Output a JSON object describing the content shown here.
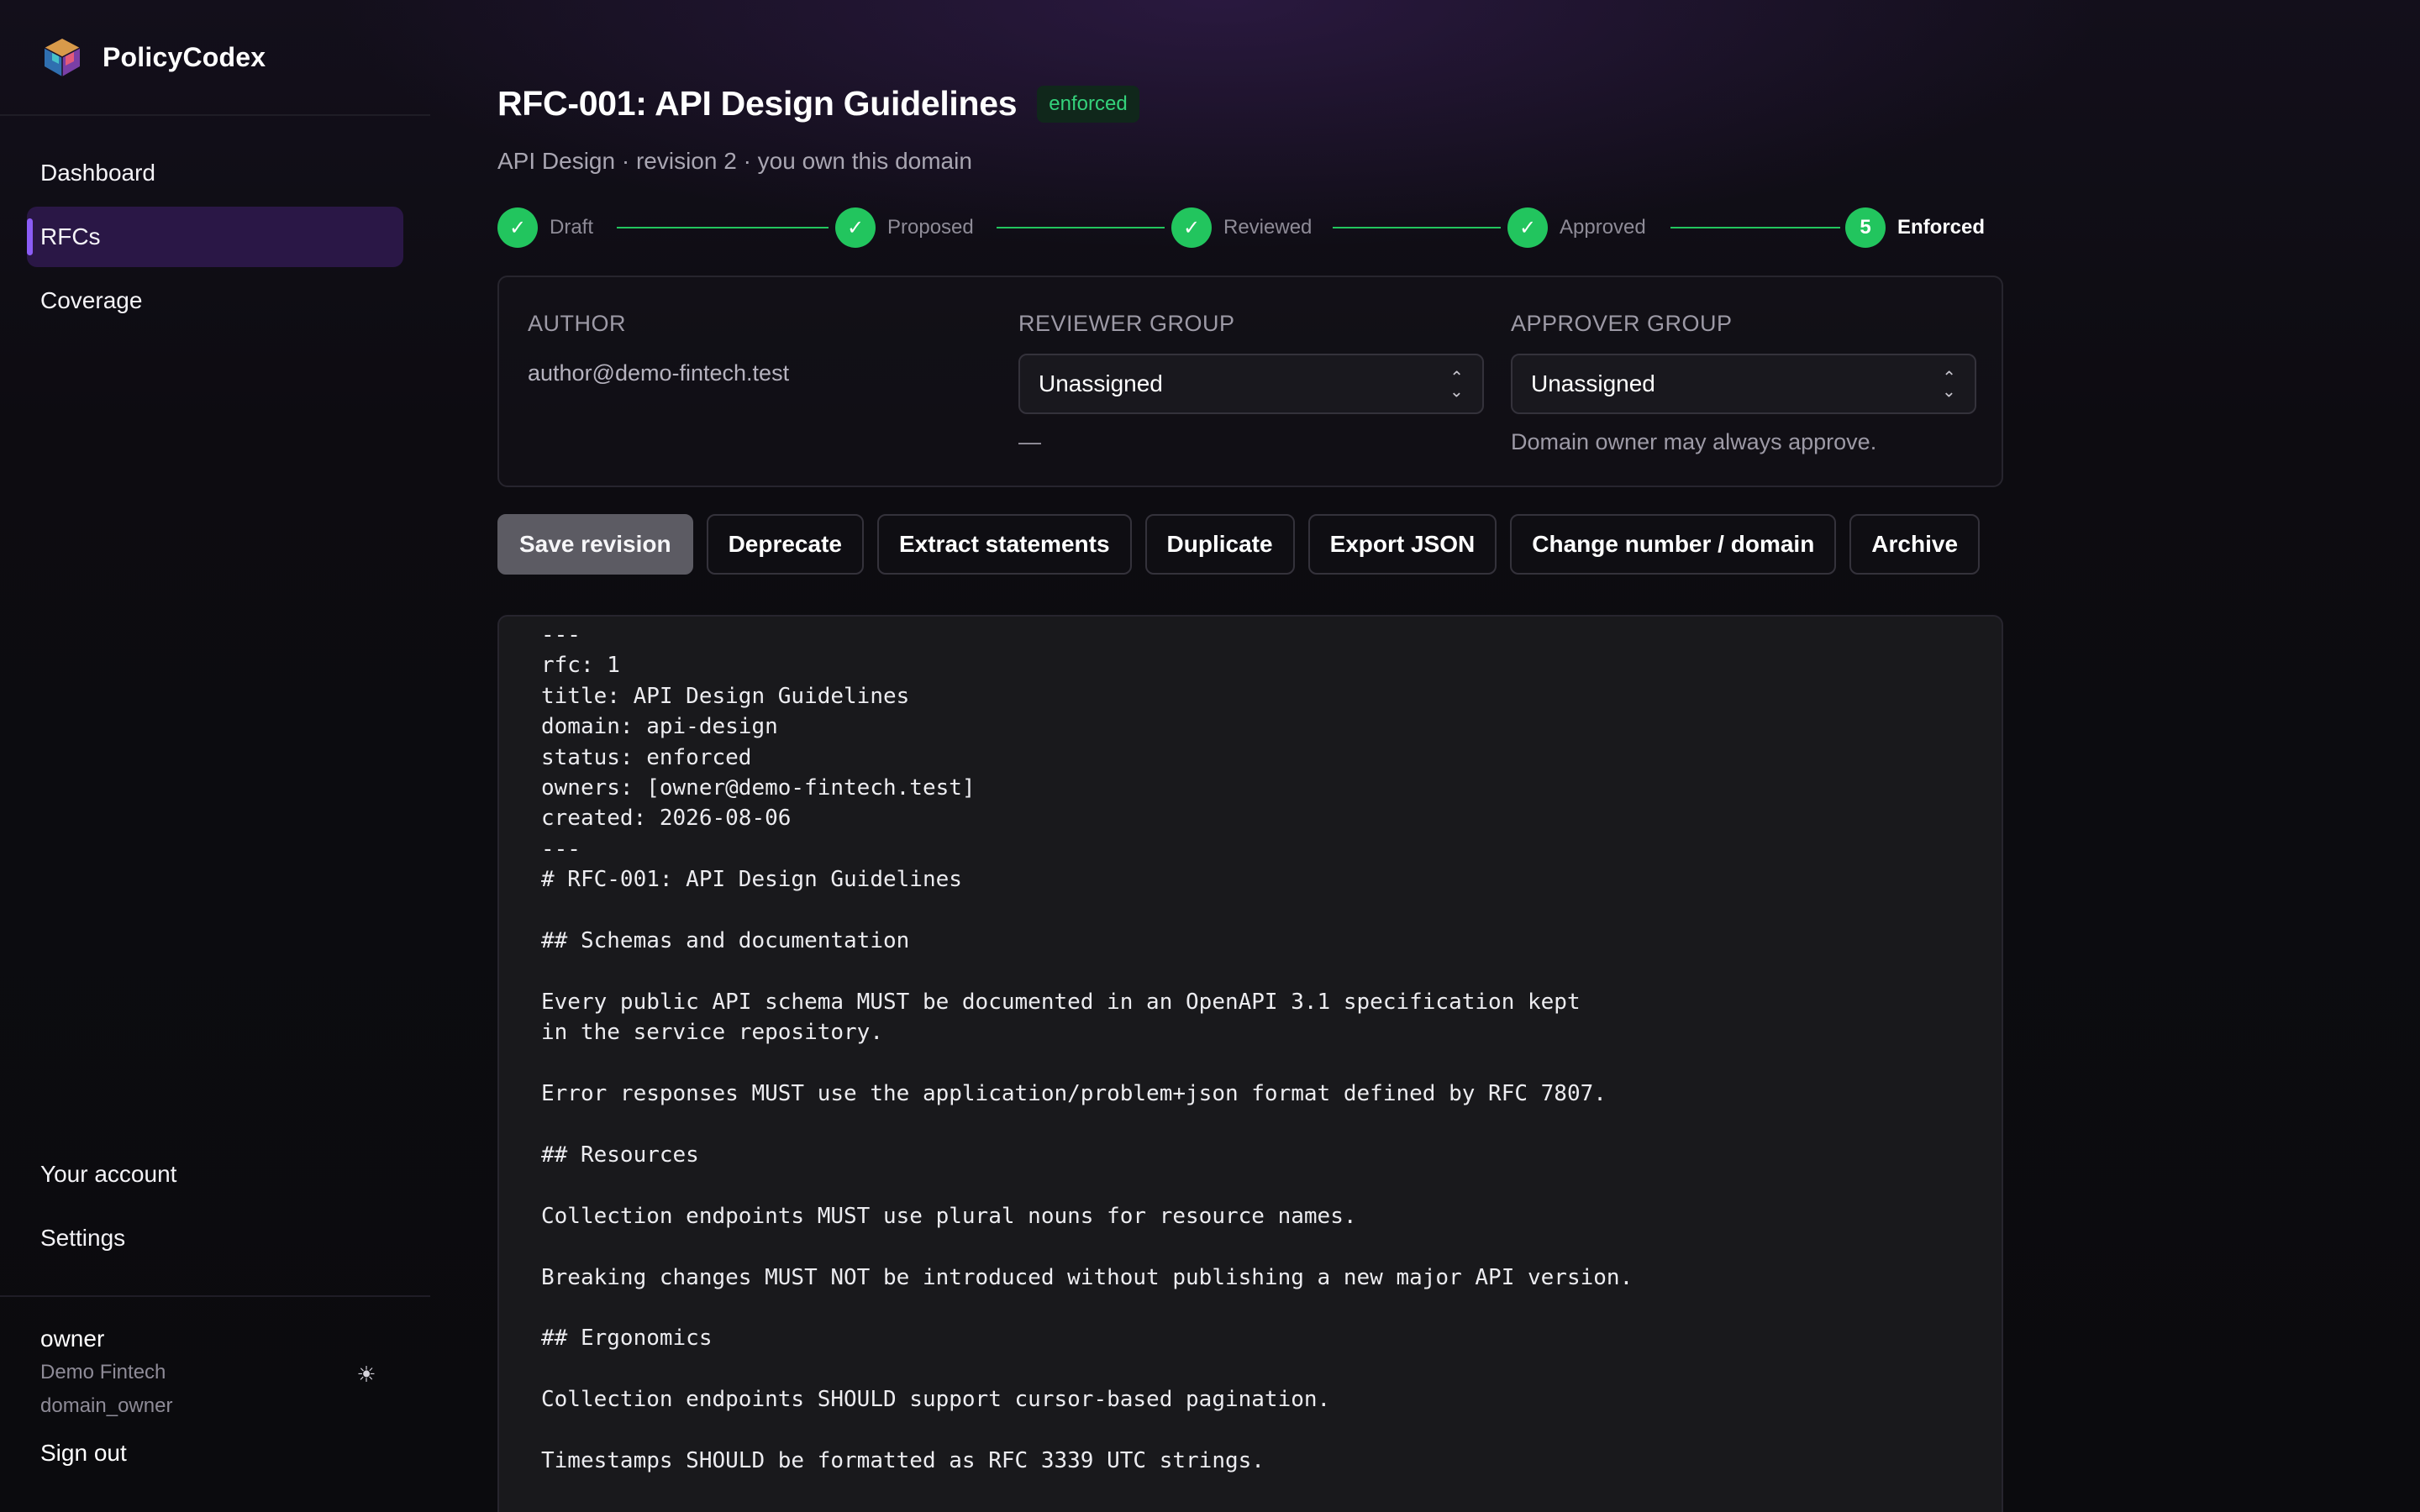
{
  "app": {
    "name": "PolicyCodex"
  },
  "nav": [
    {
      "label": "Dashboard"
    },
    {
      "label": "RFCs"
    },
    {
      "label": "Coverage"
    }
  ],
  "nav_active": "RFCs",
  "nav_bottom": [
    {
      "label": "Your account"
    },
    {
      "label": "Settings"
    }
  ],
  "user": {
    "name": "owner",
    "org": "Demo Fintech",
    "role": "domain_owner",
    "sign_out": "Sign out"
  },
  "rfc": {
    "title": "RFC-001: API Design Guidelines",
    "status": "enforced",
    "subtitle": "API Design · revision 2 · you own this domain"
  },
  "stepper": [
    {
      "label": "Draft",
      "state": "done",
      "marker": "✓"
    },
    {
      "label": "Proposed",
      "state": "done",
      "marker": "✓"
    },
    {
      "label": "Reviewed",
      "state": "done",
      "marker": "✓"
    },
    {
      "label": "Approved",
      "state": "done",
      "marker": "✓"
    },
    {
      "label": "Enforced",
      "state": "current",
      "marker": "5"
    }
  ],
  "meta": {
    "author_label": "AUTHOR",
    "author_value": "author@demo-fintech.test",
    "reviewer_label": "REVIEWER GROUP",
    "reviewer_value": "Unassigned",
    "reviewer_hint": "—",
    "approver_label": "APPROVER GROUP",
    "approver_value": "Unassigned",
    "approver_hint": "Domain owner may always approve."
  },
  "actions": {
    "save": "Save revision",
    "deprecate": "Deprecate",
    "extract": "Extract statements",
    "duplicate": "Duplicate",
    "export": "Export JSON",
    "change": "Change number / domain",
    "archive": "Archive"
  },
  "editor": {
    "content": "---\nrfc: 1\ntitle: API Design Guidelines\ndomain: api-design\nstatus: enforced\nowners: [owner@demo-fintech.test]\ncreated: 2026-08-06\n---\n# RFC-001: API Design Guidelines\n\n## Schemas and documentation\n\nEvery public API schema MUST be documented in an OpenAPI 3.1 specification kept\nin the service repository.\n\nError responses MUST use the application/problem+json format defined by RFC 7807.\n\n## Resources\n\nCollection endpoints MUST use plural nouns for resource names.\n\nBreaking changes MUST NOT be introduced without publishing a new major API version.\n\n## Ergonomics\n\nCollection endpoints SHOULD support cursor-based pagination.\n\nTimestamps SHOULD be formatted as RFC 3339 UTC strings."
  },
  "colors": {
    "accent": "#8b5cf6",
    "success": "#22c55e",
    "active_nav_bg": "#2a1746"
  },
  "icons": {
    "logo": "cube-logo-icon",
    "theme": "sun-icon",
    "select": "chevron-up-down-icon",
    "step_done": "check-icon"
  }
}
